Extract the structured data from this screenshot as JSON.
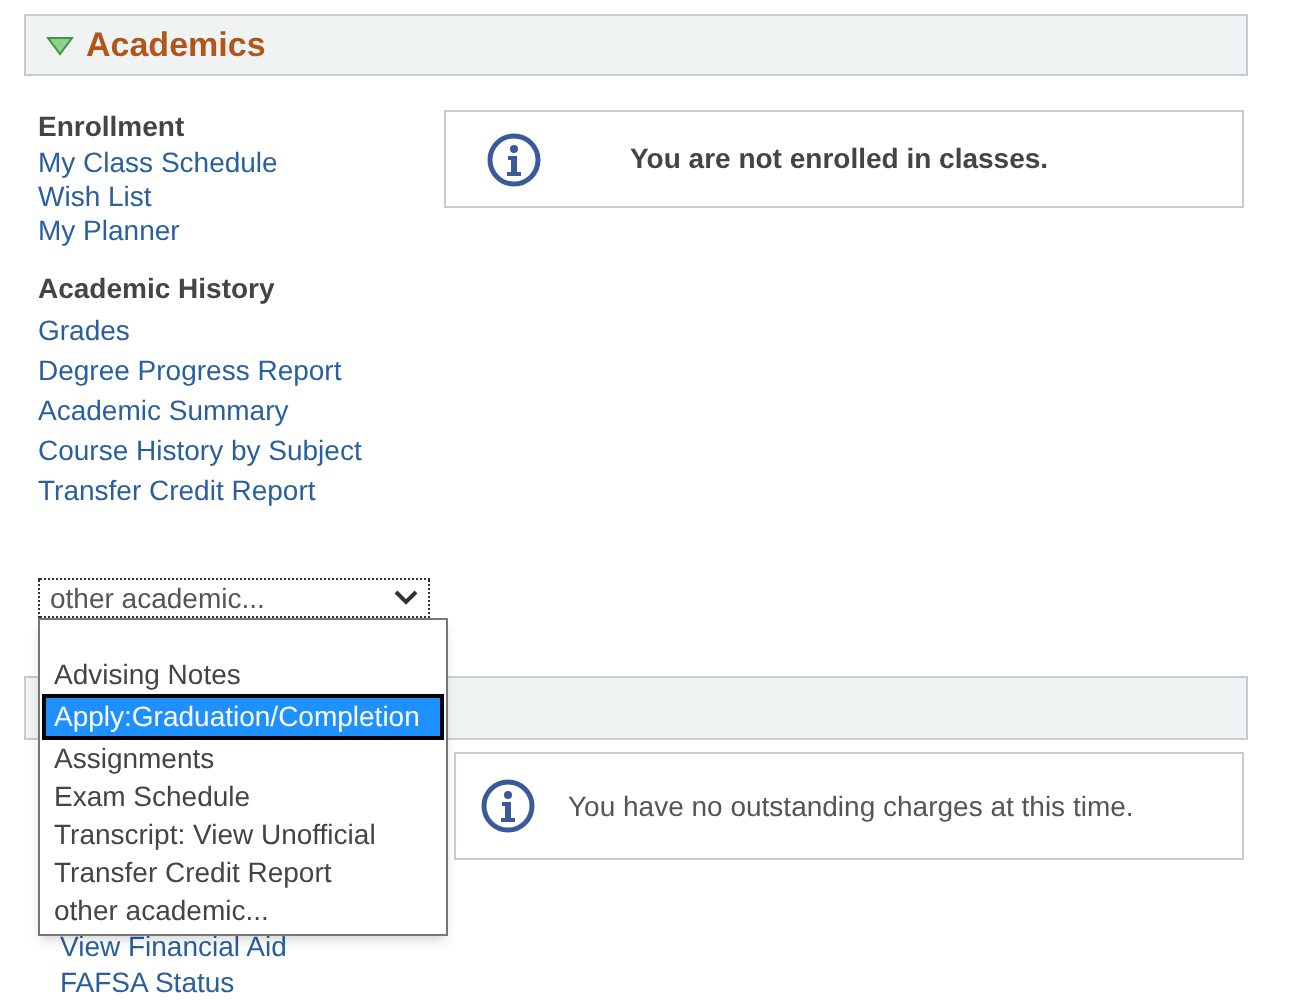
{
  "academics": {
    "title": "Academics",
    "expanded": true,
    "groups": [
      {
        "heading": "Enrollment",
        "links": [
          "My Class Schedule",
          "Wish List",
          "My Planner"
        ]
      },
      {
        "heading": "Academic History",
        "links": [
          "Grades",
          "Degree Progress Report",
          "Academic Summary",
          "Course History by Subject",
          "Transfer Credit Report"
        ]
      }
    ],
    "message": "You are not enrolled in classes.",
    "select": {
      "value": "other academic...",
      "expanded": true,
      "options": [
        {
          "label": "Advising Notes",
          "highlighted": false
        },
        {
          "label": "Apply:Graduation/Completion",
          "highlighted": true
        },
        {
          "label": "Assignments",
          "highlighted": false
        },
        {
          "label": "Exam Schedule",
          "highlighted": false
        },
        {
          "label": "Transcript: View Unofficial",
          "highlighted": false
        },
        {
          "label": "Transfer Credit Report",
          "highlighted": false
        },
        {
          "label": "other academic...",
          "highlighted": false
        }
      ]
    }
  },
  "finances": {
    "message": "You have no outstanding charges at this time.",
    "links": [
      "View Financial Aid",
      "FAFSA Status"
    ]
  }
}
